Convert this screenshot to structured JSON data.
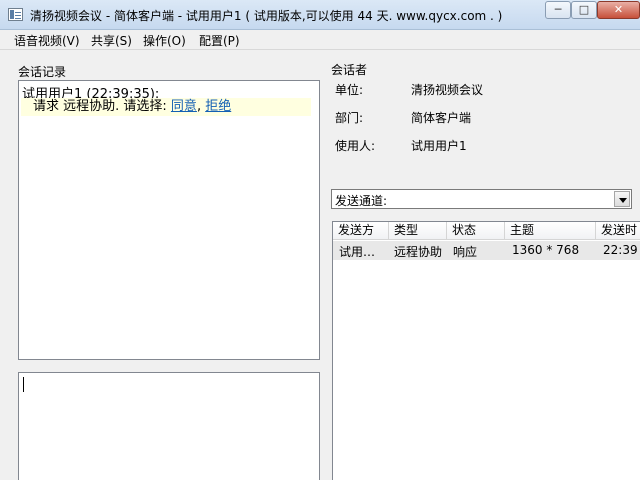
{
  "window": {
    "title": "清扬视频会议 - 简体客户端 - 试用用户1 ( 试用版本,可以使用 44 天. www.qycx.com . )",
    "controls": {
      "minimize": "─",
      "maximize": "□",
      "close": "✕"
    }
  },
  "menu": [
    "语音视频(V)",
    "共享(S)",
    "操作(O)",
    "配置(P)"
  ],
  "log": {
    "label": "会话记录",
    "entry_header": "试用用户1 (22:39:35):",
    "request_prefix": "请求  远程协助. 请选择: ",
    "accept": "同意",
    "separator": ",",
    "reject": "拒绝"
  },
  "participant": {
    "label": "会话者",
    "unit_label": "单位:",
    "unit_value": "清扬视频会议",
    "dept_label": "部门:",
    "dept_value": "简体客户端",
    "user_label": "使用人:",
    "user_value": "试用用户1"
  },
  "channel": {
    "label": "发送通道:"
  },
  "table": {
    "columns": [
      "发送方",
      "类型",
      "状态",
      "主题",
      "发送时"
    ],
    "rows": [
      [
        "试用…",
        "远程协助",
        "响应",
        "1360 * 768",
        "22:39"
      ]
    ]
  }
}
